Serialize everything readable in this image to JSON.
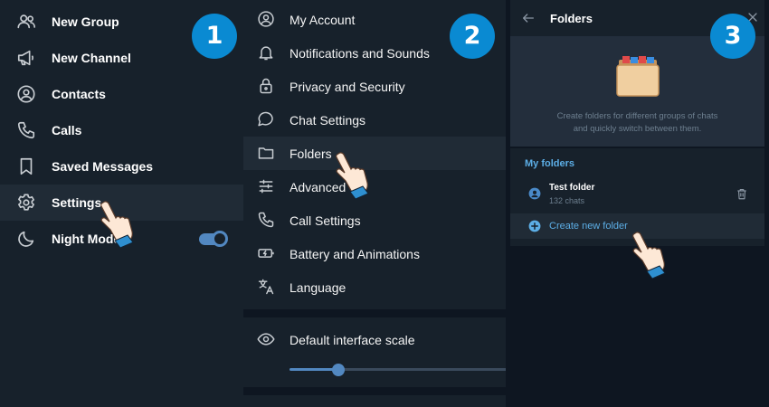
{
  "panel1": {
    "items": [
      {
        "label": "New Group",
        "icon": "group-icon"
      },
      {
        "label": "New Channel",
        "icon": "megaphone-icon"
      },
      {
        "label": "Contacts",
        "icon": "contact-icon"
      },
      {
        "label": "Calls",
        "icon": "phone-icon"
      },
      {
        "label": "Saved Messages",
        "icon": "bookmark-icon"
      },
      {
        "label": "Settings",
        "icon": "gear-icon"
      },
      {
        "label": "Night Mode",
        "icon": "moon-icon"
      }
    ],
    "night_mode_on": true,
    "badge": "1"
  },
  "panel2": {
    "items": [
      {
        "label": "My Account",
        "icon": "account-icon"
      },
      {
        "label": "Notifications and Sounds",
        "icon": "bell-icon"
      },
      {
        "label": "Privacy and Security",
        "icon": "lock-icon"
      },
      {
        "label": "Chat Settings",
        "icon": "chat-icon"
      },
      {
        "label": "Folders",
        "icon": "folder-icon"
      },
      {
        "label": "Advanced",
        "icon": "sliders-icon"
      },
      {
        "label": "Call Settings",
        "icon": "phone-icon"
      },
      {
        "label": "Battery and Animations",
        "icon": "battery-icon"
      },
      {
        "label": "Language",
        "icon": "translate-icon"
      }
    ],
    "scale_label": "Default interface scale",
    "scale_fraction": 0.2,
    "badge": "2"
  },
  "panel3": {
    "title": "Folders",
    "description_line1": "Create folders for different groups of chats",
    "description_line2": "and quickly switch between them.",
    "my_folders_label": "My folders",
    "folder": {
      "name": "Test folder",
      "count": "132 chats"
    },
    "create_label": "Create new folder",
    "badge": "3"
  },
  "colors": {
    "accent": "#5288c1",
    "link": "#5caee6",
    "badge": "#0a8ad2",
    "bg": "#17212b"
  }
}
